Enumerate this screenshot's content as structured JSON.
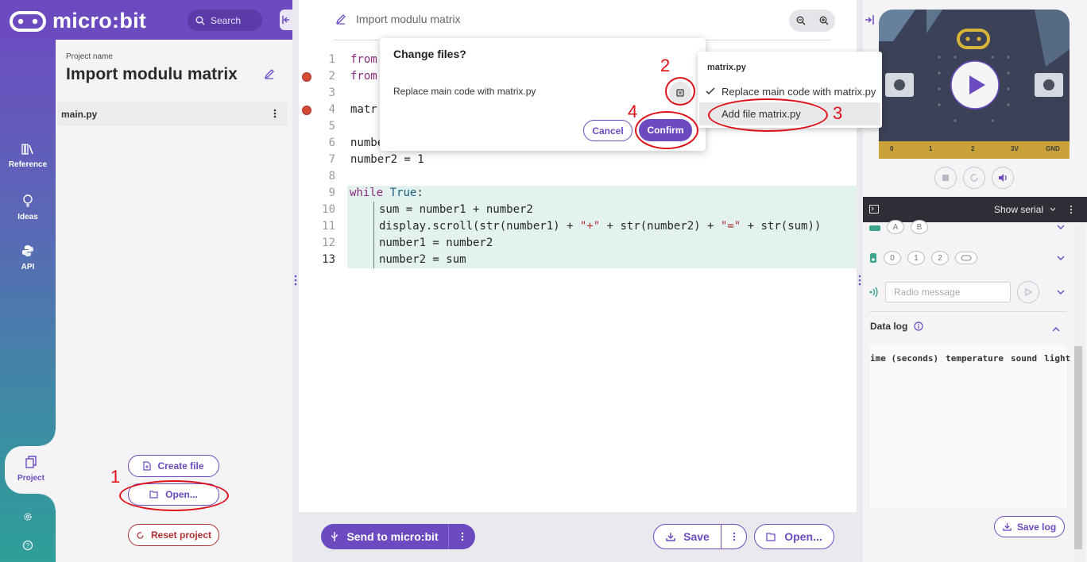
{
  "header": {
    "logo_text": "micro:bit",
    "search_label": "Search"
  },
  "sidenav": {
    "items": [
      {
        "label": "Reference",
        "icon": "books-icon"
      },
      {
        "label": "Ideas",
        "icon": "lightbulb-icon"
      },
      {
        "label": "API",
        "icon": "python-icon"
      },
      {
        "label": "Project",
        "icon": "files-icon"
      }
    ],
    "settings_icon": "gear-icon",
    "help_icon": "help-icon"
  },
  "project": {
    "name_label": "Project name",
    "name": "Import modulu matrix",
    "files": [
      {
        "name": "main.py"
      }
    ],
    "create_file_label": "Create file",
    "open_label": "Open...",
    "reset_label": "Reset project"
  },
  "editor": {
    "title": "Import modulu matrix",
    "line_numbers": [
      "1",
      "2",
      "3",
      "4",
      "5",
      "6",
      "7",
      "8",
      "9",
      "10",
      "11",
      "12",
      "13"
    ],
    "lines": {
      "l1": "from",
      "l2": "from",
      "l4": "matr",
      "l6": "numbe",
      "l7": "number2 = 1",
      "l9_kw": "while",
      "l9_val": "True",
      "l9_colon": ":",
      "l10": "sum = number1 + number2",
      "l11_a": "display.scroll(str(number1) + ",
      "l11_s1": "\"+\"",
      "l11_b": " + str(number2) + ",
      "l11_s2": "\"=\"",
      "l11_c": " + str(sum))",
      "l12": "number1 = number2",
      "l13": "number2 = sum"
    },
    "error_lines": [
      2,
      4
    ],
    "current_line": 13
  },
  "toolbar": {
    "send_label": "Send to micro:bit",
    "save_label": "Save",
    "open_label": "Open..."
  },
  "simulator": {
    "pin_labels": [
      "0",
      "1",
      "2",
      "3V",
      "GND"
    ],
    "serial_label": "Show serial",
    "button_chips": [
      "A",
      "B"
    ],
    "pin_chips": [
      "0",
      "1",
      "2"
    ],
    "radio_placeholder": "Radio message",
    "datalog_title": "Data log",
    "datalog_columns": [
      "ime (seconds)",
      "temperature",
      "sound",
      "light"
    ],
    "save_log_label": "Save log"
  },
  "dialog": {
    "title": "Change files?",
    "row_text": "Replace main code with matrix.py",
    "cancel_label": "Cancel",
    "confirm_label": "Confirm"
  },
  "popup": {
    "heading": "matrix.py",
    "options": [
      {
        "label": "Replace main code with matrix.py",
        "checked": true
      },
      {
        "label": "Add file matrix.py",
        "checked": false
      }
    ]
  },
  "annotations": [
    "1",
    "2",
    "3",
    "4"
  ],
  "colors": {
    "brand": "#6c4bc1",
    "error": "#d24a36",
    "annotation": "#e0101a"
  }
}
